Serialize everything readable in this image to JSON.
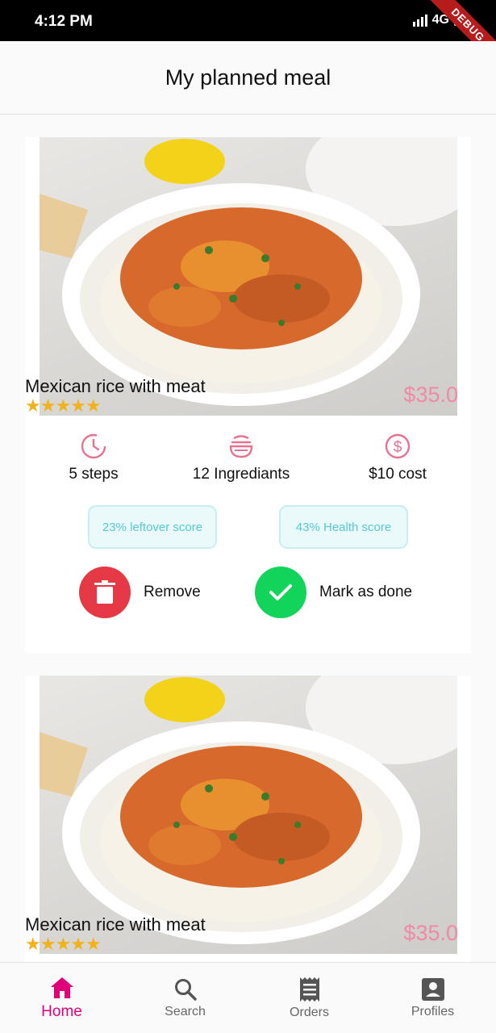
{
  "status_bar": {
    "time": "4:12 PM",
    "network": "4G",
    "debug_label": "DEBUG"
  },
  "app_bar": {
    "title": "My planned meal"
  },
  "meals": [
    {
      "name": "Mexican rice with meat",
      "rating": 5,
      "price": "$35.0",
      "steps": "5 steps",
      "ingredients": "12 Ingrediants",
      "cost": "$10 cost",
      "leftover_score": "23% leftover score",
      "health_score": "43% Health score",
      "remove_label": "Remove",
      "done_label": "Mark as done"
    },
    {
      "name": "Mexican rice with meat",
      "rating": 5,
      "price": "$35.0"
    }
  ],
  "bottom_nav": {
    "items": [
      {
        "label": "Home",
        "icon": "home-icon",
        "active": true
      },
      {
        "label": "Search",
        "icon": "search-icon",
        "active": false
      },
      {
        "label": "Orders",
        "icon": "receipt-icon",
        "active": false
      },
      {
        "label": "Profiles",
        "icon": "account-box-icon",
        "active": false
      }
    ]
  },
  "colors": {
    "accent": "#e0007a",
    "price": "#f08aa3",
    "remove": "#e53945",
    "done": "#12d45a",
    "score_text": "#58c9d2",
    "icon_pink": "#e8728f",
    "star": "#f2b21b"
  }
}
